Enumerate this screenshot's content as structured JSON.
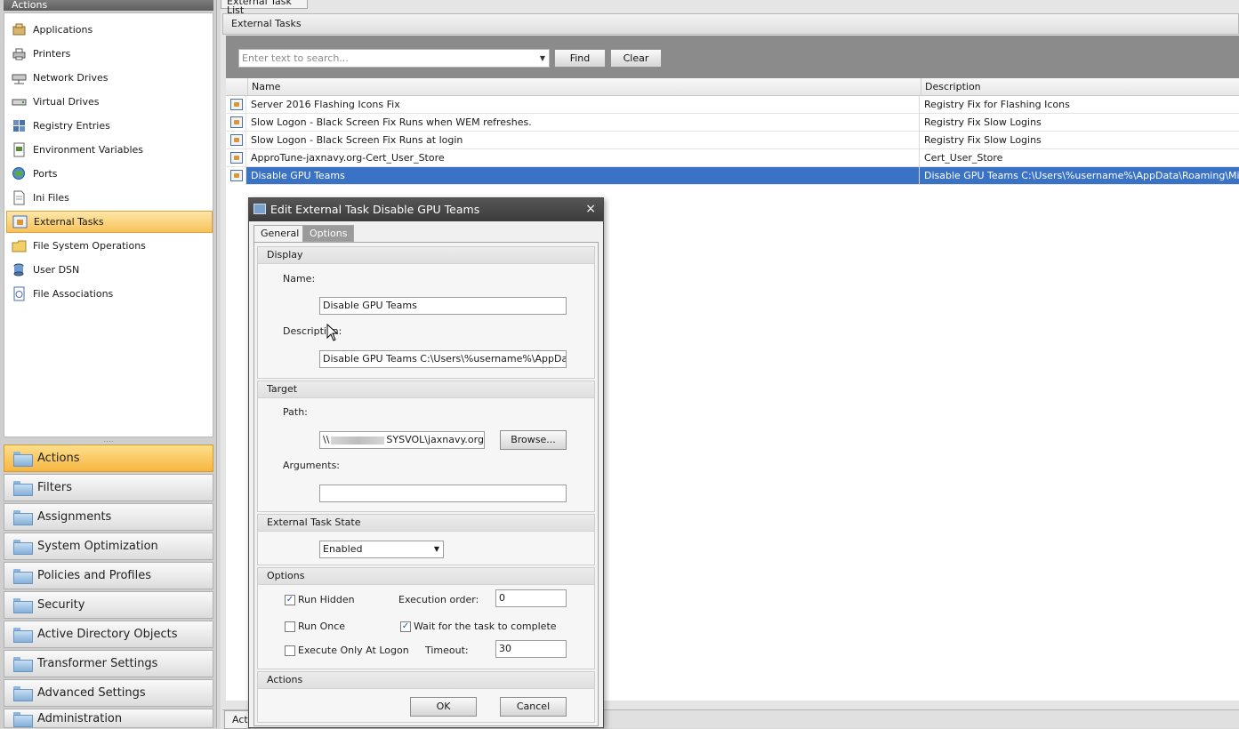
{
  "sidebar": {
    "header": "Actions",
    "items": [
      {
        "label": "Applications",
        "icon": "applications-icon"
      },
      {
        "label": "Printers",
        "icon": "printer-icon"
      },
      {
        "label": "Network Drives",
        "icon": "network-drive-icon"
      },
      {
        "label": "Virtual Drives",
        "icon": "virtual-drive-icon"
      },
      {
        "label": "Registry Entries",
        "icon": "registry-icon"
      },
      {
        "label": "Environment Variables",
        "icon": "environment-variables-icon"
      },
      {
        "label": "Ports",
        "icon": "ports-icon"
      },
      {
        "label": "Ini Files",
        "icon": "ini-file-icon"
      },
      {
        "label": "External Tasks",
        "icon": "external-task-icon",
        "selected": true
      },
      {
        "label": "File System Operations",
        "icon": "file-system-icon"
      },
      {
        "label": "User DSN",
        "icon": "user-dsn-icon"
      },
      {
        "label": "File Associations",
        "icon": "file-association-icon"
      }
    ],
    "nav": [
      {
        "label": "Actions",
        "selected": true
      },
      {
        "label": "Filters"
      },
      {
        "label": "Assignments"
      },
      {
        "label": "System Optimization"
      },
      {
        "label": "Policies and Profiles"
      },
      {
        "label": "Security"
      },
      {
        "label": "Active Directory Objects"
      },
      {
        "label": "Transformer Settings"
      },
      {
        "label": "Advanced Settings"
      },
      {
        "label": "Administration"
      }
    ]
  },
  "main": {
    "top_tab": "External Task List",
    "panel_title": "External Tasks",
    "search": {
      "placeholder": "Enter text to search...",
      "find": "Find",
      "clear": "Clear"
    },
    "columns": [
      "Name",
      "Description"
    ],
    "rows": [
      {
        "name": "Server 2016 Flashing Icons Fix",
        "description": "Registry Fix for Flashing Icons"
      },
      {
        "name": "Slow Logon - Black Screen Fix Runs when WEM refreshes.",
        "description": "Registry Fix Slow Logins"
      },
      {
        "name": "Slow Logon - Black Screen Fix Runs at login",
        "description": "Registry Fix Slow Logins"
      },
      {
        "name": "ApproTune-jaxnavy.org-Cert_User_Store",
        "description": "Cert_User_Store"
      },
      {
        "name": "Disable GPU Teams",
        "description": "Disable GPU Teams  C:\\Users\\%username%\\AppData\\Roaming\\Microsoft\\",
        "selected": true
      }
    ],
    "bottom_tab": "Actions"
  },
  "dialog": {
    "title": "Edit External Task Disable GPU Teams",
    "close": "×",
    "tabs": [
      "General",
      "Options"
    ],
    "display": {
      "header": "Display",
      "name_label": "Name:",
      "name_value": "Disable GPU Teams",
      "description_label": "Description:",
      "description_value": "Disable GPU Teams  C:\\Users\\%username%\\AppData\\Ro"
    },
    "target": {
      "header": "Target",
      "path_label": "Path:",
      "path_prefix": "\\\\",
      "path_suffix": "SYSVOL\\jaxnavy.org\\s",
      "browse": "Browse...",
      "arguments_label": "Arguments:",
      "arguments_value": ""
    },
    "state": {
      "header": "External Task State",
      "value": "Enabled"
    },
    "options": {
      "header": "Options",
      "run_hidden": "Run Hidden",
      "run_hidden_checked": true,
      "execution_order_label": "Execution order:",
      "execution_order": "0",
      "run_once": "Run Once",
      "run_once_checked": false,
      "wait_label": "Wait for the task to complete",
      "wait_checked": true,
      "logon_only": "Execute Only At Logon",
      "logon_only_checked": false,
      "timeout_label": "Timeout:",
      "timeout": "30"
    },
    "actions": {
      "header": "Actions",
      "ok": "OK",
      "cancel": "Cancel"
    }
  }
}
